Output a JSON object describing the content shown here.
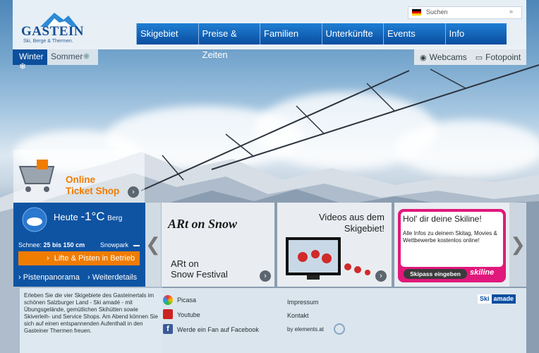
{
  "brand": {
    "name": "GASTEIN",
    "tagline": "Ski, Berge & Thermen."
  },
  "search": {
    "placeholder": "Suchen",
    "go_icon": "double-chevron-icon"
  },
  "nav": {
    "items": [
      "Skigebiet",
      "Preise & Zeiten",
      "Familien",
      "Unterkünfte",
      "Events",
      "Info"
    ]
  },
  "season": {
    "winter": "Winter",
    "sommer": "Sommer"
  },
  "tools": {
    "webcams": "Webcams",
    "fotopoint": "Fotopoint"
  },
  "ticket": {
    "line1": "Online",
    "line2": "Ticket Shop"
  },
  "weather": {
    "today": "Heute",
    "temp": "-1°C",
    "location": "Berg",
    "snow_label": "Schnee:",
    "snow_value": "25 bis 150 cm",
    "snowpark": "Snowpark",
    "lifts_button": "Lifte & Pisten in Betrieb",
    "panorama": "Pistenpanorama",
    "forecast": "Weiterdetails"
  },
  "panels": [
    {
      "logo": "ARt on Snow",
      "title_line1": "ARt on",
      "title_line2": "Snow Festival"
    },
    {
      "title_line1": "Videos aus dem",
      "title_line2": "Skigebiet!"
    },
    {
      "heading": "Hol' dir deine Skiline!",
      "body": "Alle Infos zu deinem Skitag, Movies & Wettbewerbe kostenlos online!",
      "button": "Skipass eingeben",
      "brand": "skiline"
    }
  ],
  "carousel": {
    "prev": "❮",
    "next": "❯"
  },
  "footer": {
    "text": "Erleben Sie die vier Skigebiete des Gasteinertals im schönen Salzburger Land - Ski amadé - mit Übungsgelände, gemütlichen Skihütten sowie Skiverleih- und Service Shops. Am Abend können Sie sich auf einen entspannenden Aufenthalt in den Gasteiner Thermen freuen.",
    "social": {
      "picasa": "Picasa",
      "youtube": "Youtube",
      "facebook": "Werde ein Fan auf Facebook"
    },
    "links": {
      "impressum": "Impressum",
      "kontakt": "Kontakt",
      "by": "by elements.at"
    },
    "ski_amade": {
      "ski": "Ski",
      "amade": "amade"
    }
  },
  "colors": {
    "nav": "#0a4d9f",
    "accent": "#f07c00",
    "pink": "#e0187b"
  }
}
